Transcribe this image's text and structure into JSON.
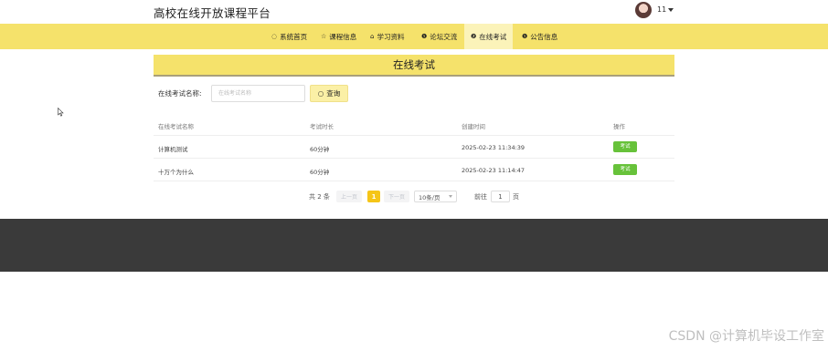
{
  "header": {
    "site_title": "高校在线开放课程平台",
    "username": "11"
  },
  "nav": {
    "items": [
      {
        "icon": "◌",
        "label": "系统首页"
      },
      {
        "icon": "☆",
        "label": "课程信息"
      },
      {
        "icon": "⌂",
        "label": "学习资料"
      },
      {
        "icon": "❶",
        "label": "论坛交流"
      },
      {
        "icon": "❷",
        "label": "在线考试"
      },
      {
        "icon": "❶",
        "label": "公告信息"
      }
    ],
    "active_index": 4
  },
  "page": {
    "title": "在线考试"
  },
  "search": {
    "label": "在线考试名称:",
    "placeholder": "在线考试名称",
    "button_icon": "○",
    "button_label": "查询"
  },
  "table": {
    "headers": [
      "在线考试名称",
      "考试时长",
      "创建时间",
      "操作"
    ],
    "rows": [
      {
        "name": "计算机测试",
        "duration": "60分钟",
        "created": "2025-02-23 11:34:39",
        "action": "考试"
      },
      {
        "name": "十万个为什么",
        "duration": "60分钟",
        "created": "2025-02-23 11:14:47",
        "action": "考试"
      }
    ]
  },
  "pagination": {
    "total": "共 2 条",
    "prev": "上一页",
    "current_page": "1",
    "next": "下一页",
    "page_size": "10条/页",
    "goto_prefix": "前往",
    "goto_value": "1",
    "goto_suffix": "页"
  },
  "colors": {
    "nav_bg": "#f5e26b",
    "exam_button": "#67c23a",
    "footer": "#3a3a3a"
  },
  "watermark": "CSDN @计算机毕设工作室"
}
